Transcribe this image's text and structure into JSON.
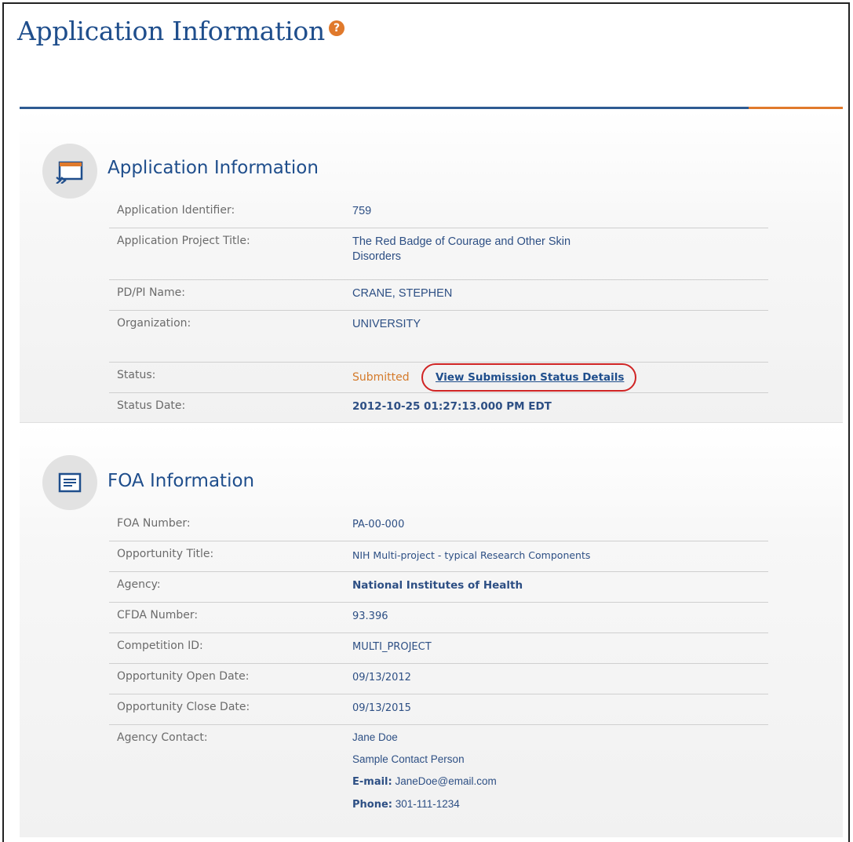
{
  "page": {
    "title": "Application Information",
    "help_icon": "question-icon"
  },
  "colors": {
    "title_blue": "#1f4e8c",
    "accent_orange": "#e07a2c",
    "status_orange": "#d47a2a",
    "highlight_red": "#d02424"
  },
  "application_section": {
    "title": "Application Information",
    "icon": "application-window-icon",
    "rows": [
      {
        "label": "Application Identifier:",
        "value": "759"
      },
      {
        "label": "Application Project Title:",
        "value_line1": "The Red Badge of Courage and Other Skin",
        "value_line2": "Disorders"
      },
      {
        "label": "PD/PI Name:",
        "value": "CRANE, STEPHEN"
      },
      {
        "label": "Organization:",
        "value": "UNIVERSITY"
      },
      {
        "label": "Status:",
        "value": "Submitted",
        "link": "View Submission Status Details"
      },
      {
        "label": "Status Date:",
        "value": "2012-10-25 01:27:13.000 PM EDT"
      }
    ]
  },
  "foa_section": {
    "title": "FOA Information",
    "icon": "document-list-icon",
    "rows": [
      {
        "label": "FOA Number:",
        "value": "PA-00-000"
      },
      {
        "label": "Opportunity Title:",
        "value": "NIH Multi-project - typical Research Components"
      },
      {
        "label": "Agency:",
        "value": "National Institutes of Health"
      },
      {
        "label": "CFDA Number:",
        "value": "93.396"
      },
      {
        "label": "Competition ID:",
        "value": "MULTI_PROJECT"
      },
      {
        "label": "Opportunity Open Date:",
        "value": "09/13/2012"
      },
      {
        "label": "Opportunity Close Date:",
        "value": "09/13/2015"
      },
      {
        "label": "Agency Contact:",
        "name": "Jane Doe",
        "role": "Sample Contact Person",
        "email_label": "E-mail:",
        "email": "JaneDoe@email.com",
        "phone_label": "Phone:",
        "phone": "301-111-1234"
      }
    ]
  }
}
